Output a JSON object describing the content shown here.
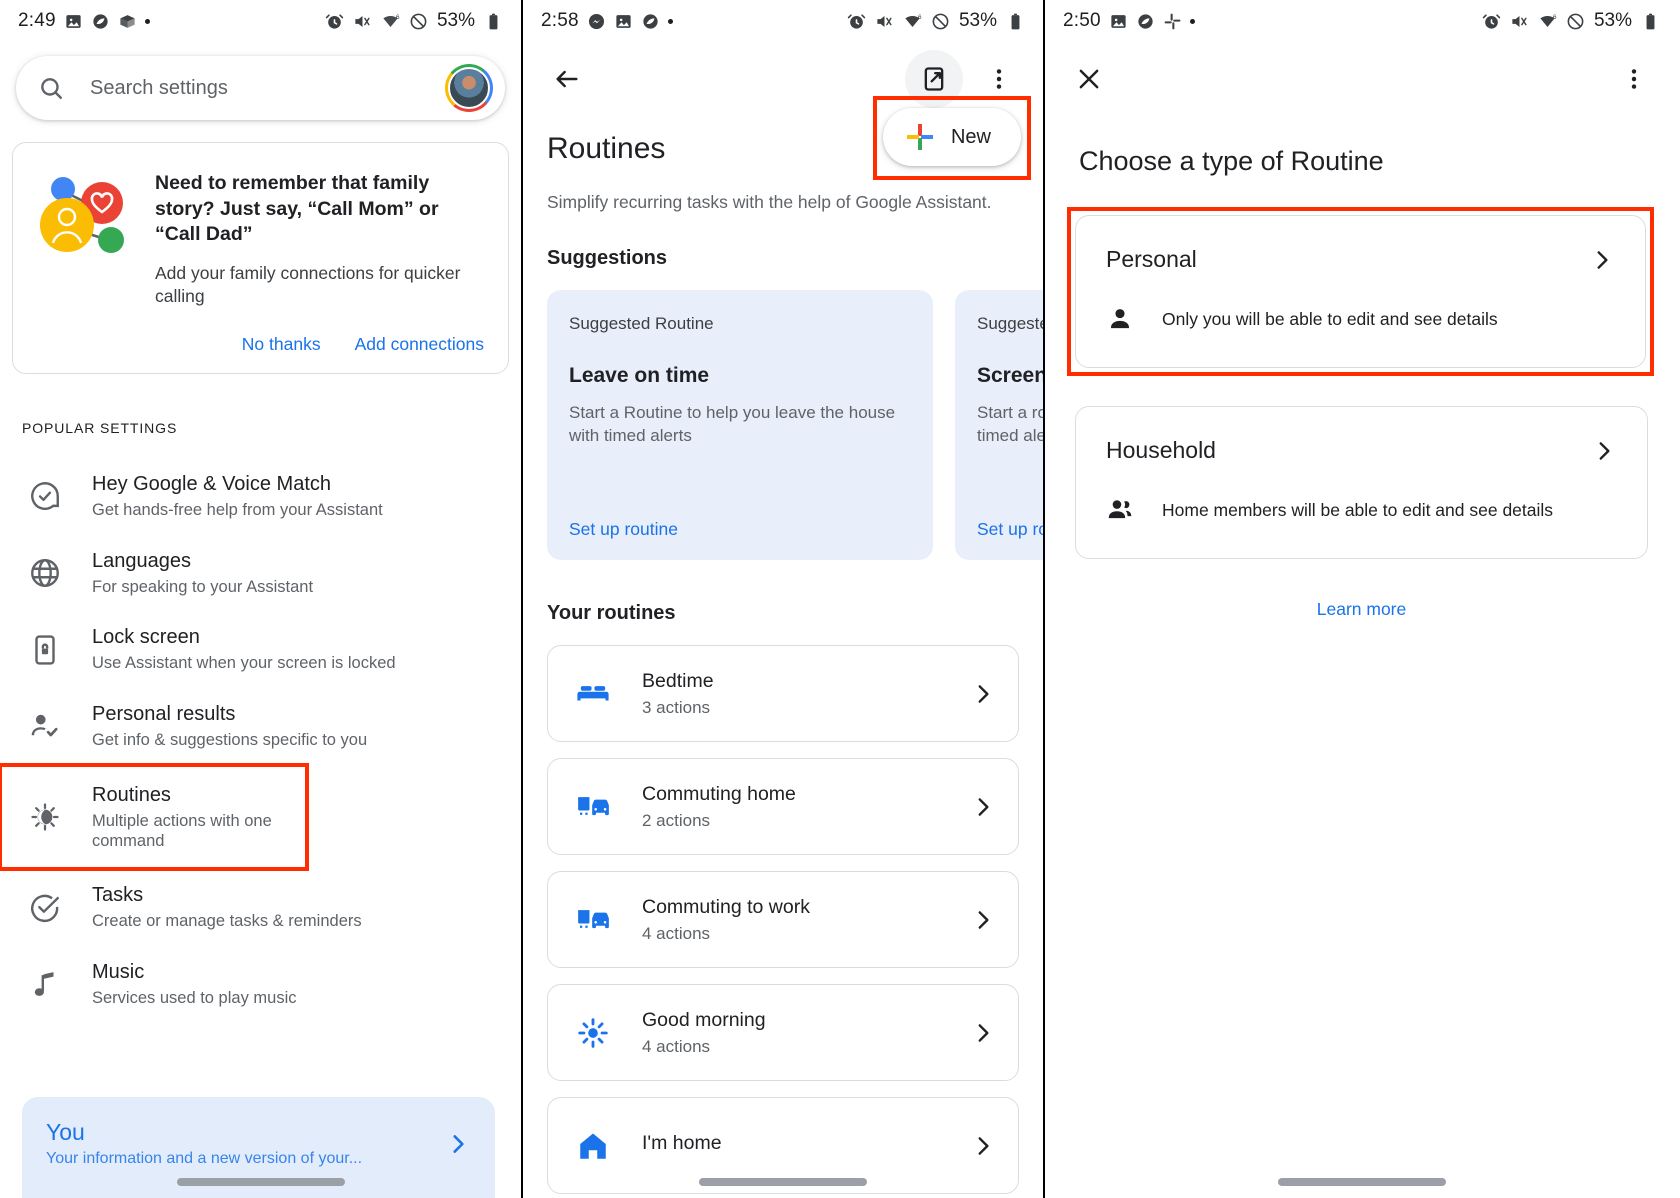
{
  "panel1": {
    "status": {
      "time": "2:49",
      "battery": "53%",
      "icons": [
        "photos-icon",
        "drive-icon",
        "package-icon",
        "dot-icon"
      ],
      "right_icons": [
        "alarm-icon",
        "vibrate-mute-icon",
        "wifi-6-icon",
        "do-not-disturb-icon",
        "battery-icon"
      ]
    },
    "search": {
      "placeholder": "Search settings",
      "icon": "search-icon",
      "avatar": "user-avatar"
    },
    "promo": {
      "title": "Need to remember that family story? Just say, “Call Mom” or “Call Dad”",
      "subtitle": "Add your family connections for quicker calling",
      "decline_label": "No thanks",
      "accept_label": "Add connections"
    },
    "section_label": "POPULAR SETTINGS",
    "settings": [
      {
        "title": "Hey Google & Voice Match",
        "subtitle": "Get hands-free help from your Assistant",
        "icon": "assistant-check-icon",
        "highlighted": false
      },
      {
        "title": "Languages",
        "subtitle": "For speaking to your Assistant",
        "icon": "globe-icon",
        "highlighted": false
      },
      {
        "title": "Lock screen",
        "subtitle": "Use Assistant when your screen is locked",
        "icon": "phone-lock-icon",
        "highlighted": false
      },
      {
        "title": "Personal results",
        "subtitle": "Get info & suggestions specific to you",
        "icon": "person-check-icon",
        "highlighted": false
      },
      {
        "title": "Routines",
        "subtitle": "Multiple actions with one command",
        "icon": "routines-icon",
        "highlighted": true
      },
      {
        "title": "Tasks",
        "subtitle": "Create or manage tasks & reminders",
        "icon": "task-check-icon",
        "highlighted": false
      },
      {
        "title": "Music",
        "subtitle": "Services used to play music",
        "icon": "music-note-icon",
        "highlighted": false
      }
    ],
    "you_card": {
      "title": "You",
      "subtitle": "Your information and a new version of your..."
    }
  },
  "panel2": {
    "status": {
      "time": "2:58",
      "battery": "53%"
    },
    "appbar": {
      "back_icon": "back-arrow-icon",
      "cast_icon": "cast-screen-icon",
      "overflow_icon": "more-vert-icon"
    },
    "page_title": "Routines",
    "page_subtitle": "Simplify recurring tasks with the help of Google Assistant.",
    "new_button": {
      "label": "New",
      "icon": "google-plus-icon"
    },
    "suggestions_heading": "Suggestions",
    "suggestions": [
      {
        "kicker": "Suggested Routine",
        "name": "Leave on time",
        "description": "Start a Routine to help you leave the house with timed alerts",
        "cta": "Set up routine"
      },
      {
        "kicker": "Suggested Routine",
        "name": "Screen time",
        "description": "Start a routine to help you wind down with timed alerts",
        "cta": "Set up routine"
      }
    ],
    "your_routines_heading": "Your routines",
    "routines": [
      {
        "name": "Bedtime",
        "actions": "3 actions",
        "icon": "bed-icon"
      },
      {
        "name": "Commuting home",
        "actions": "2 actions",
        "icon": "commute-icon"
      },
      {
        "name": "Commuting to work",
        "actions": "4 actions",
        "icon": "commute-icon"
      },
      {
        "name": "Good morning",
        "actions": "4 actions",
        "icon": "sun-icon"
      },
      {
        "name": "I'm home",
        "actions": "",
        "icon": "home-icon"
      }
    ]
  },
  "panel3": {
    "status": {
      "time": "2:50",
      "battery": "53%"
    },
    "appbar": {
      "close_icon": "close-icon",
      "overflow_icon": "more-vert-icon"
    },
    "title": "Choose a type of Routine",
    "types": [
      {
        "name": "Personal",
        "detail": "Only you will be able to edit and see details",
        "icon": "person-icon",
        "highlighted": true
      },
      {
        "name": "Household",
        "detail": "Home members will be able to edit and see details",
        "icon": "people-icon",
        "highlighted": false
      }
    ],
    "learn_more": "Learn more"
  },
  "colors": {
    "accent_blue": "#1a73e8",
    "highlight_red": "#ff2d00",
    "card_blue": "#e8eefa"
  }
}
